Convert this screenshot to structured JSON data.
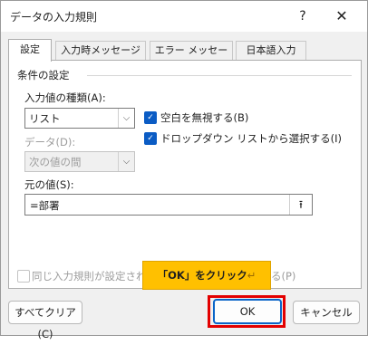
{
  "window": {
    "title": "データの入力規則",
    "help_glyph": "?",
    "close_glyph": "✕"
  },
  "tabs": [
    {
      "label": "設定",
      "active": true
    },
    {
      "label": "入力時メッセージ",
      "active": false
    },
    {
      "label": "エラー メッセージ",
      "active": false
    },
    {
      "label": "日本語入力",
      "active": false
    }
  ],
  "settings": {
    "group_label": "条件の設定",
    "allow_label": "入力値の種類(A):",
    "allow_value": "リスト",
    "data_label": "データ(D):",
    "data_value": "次の値の間",
    "ignore_blank": {
      "label": "空白を無視する(B)",
      "checked": true
    },
    "in_cell_dropdown": {
      "label": "ドロップダウン リストから選択する(I)",
      "checked": true
    },
    "source_label": "元の値(S):",
    "source_value": "=部署",
    "apply_all": {
      "label_start": "同じ入力規則が設定され",
      "label_end": "る(P)",
      "checked": false
    }
  },
  "callout": {
    "text": "「OK」をクリック",
    "return_mark": "↵"
  },
  "buttons": {
    "clear_all": "すべてクリア(C)",
    "ok": "OK",
    "cancel": "キャンセル"
  },
  "icons": {
    "dropdown": "chevron-down-icon",
    "range_picker": "collapse-dialog-icon",
    "check": "check-icon"
  },
  "colors": {
    "accent": "#0b5cc4",
    "callout": "#ffc000",
    "highlight": "#e30000"
  }
}
